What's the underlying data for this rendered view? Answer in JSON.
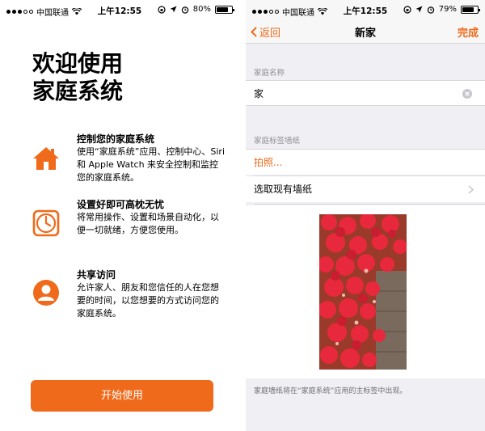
{
  "left": {
    "status": {
      "carrier": "中国联通",
      "time": "上午12:55",
      "battery": "80%",
      "battery_level": 0.8
    },
    "title_line1": "欢迎使用",
    "title_line2": "家庭系统",
    "features": [
      {
        "title": "控制您的家庭系统",
        "desc": "使用“家庭系统”应用、控制中心、Siri 和 Apple Watch 来安全控制和监控您的家庭系统。",
        "icon": "house-icon"
      },
      {
        "title": "设置好即可高枕无忧",
        "desc": "将常用操作、设置和场景自动化，以便一切就绪，方便您使用。",
        "icon": "clock-icon"
      },
      {
        "title": "共享访问",
        "desc": "允许家人、朋友和您信任的人在您想要的时间，以您想要的方式访问您的家庭系统。",
        "icon": "person-icon"
      }
    ],
    "start_button": "开始使用"
  },
  "right": {
    "status": {
      "carrier": "中国联通",
      "time": "上午12:55",
      "battery": "79%",
      "battery_level": 0.79
    },
    "nav": {
      "back": "返回",
      "title": "新家",
      "done": "完成"
    },
    "home_name_label": "家庭名称",
    "home_name_value": "家",
    "wallpaper_label": "家庭标签墙纸",
    "take_photo": "拍照...",
    "choose_existing": "选取现有墙纸",
    "footer": "家庭墙纸将在“家庭系统”应用的主标签中出现。"
  },
  "colors": {
    "accent": "#ef6a1a",
    "grouped_bg": "#efeff4",
    "separator": "#d8d8d8",
    "secondary_text": "#8e8e93"
  }
}
